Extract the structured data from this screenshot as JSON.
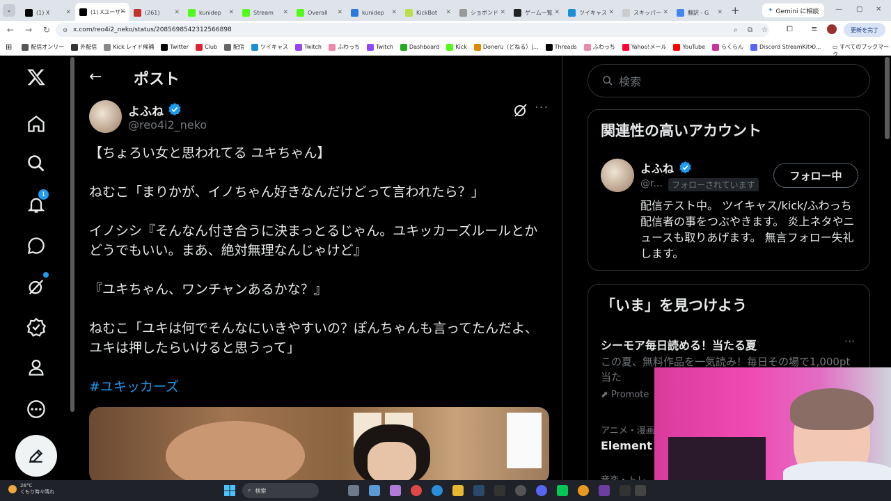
{
  "browser": {
    "tabs": [
      {
        "label": "(1) X",
        "fav": "#000",
        "active": false
      },
      {
        "label": "(1) Xユーザー",
        "fav": "#000",
        "active": true
      },
      {
        "label": "(261)",
        "fav": "#c4302b",
        "active": false
      },
      {
        "label": "kunidep",
        "fav": "#53fc18",
        "active": false
      },
      {
        "label": "Stream",
        "fav": "#53fc18",
        "active": false
      },
      {
        "label": "Overall",
        "fav": "#53fc18",
        "active": false
      },
      {
        "label": "kunidep",
        "fav": "#2a7bd8",
        "active": false
      },
      {
        "label": "KickBot",
        "fav": "#b9e04a",
        "active": false
      },
      {
        "label": "ショボンド",
        "fav": "#999",
        "active": false
      },
      {
        "label": "ゲーム一覧",
        "fav": "#222",
        "active": false
      },
      {
        "label": "ツイキャス",
        "fav": "#1a8fd6",
        "active": false
      },
      {
        "label": "スキッパー",
        "fav": "#ccc",
        "active": false
      },
      {
        "label": "翻訳 - G",
        "fav": "#4285f4",
        "active": false
      }
    ],
    "gemini_label": "Gemini に相談",
    "url": "x.com/reo4i2_neko/status/2085698542312566898",
    "update_label": "更新を完了",
    "bookmarks": [
      {
        "label": "配信オンリー",
        "color": "#555"
      },
      {
        "label": "外配信",
        "color": "#333"
      },
      {
        "label": "Kick レイド候補",
        "color": "#888"
      },
      {
        "label": "Twitter",
        "color": "#000"
      },
      {
        "label": "Club",
        "color": "#d23"
      },
      {
        "label": "配信",
        "color": "#666"
      },
      {
        "label": "ツイキャス",
        "color": "#1a8fd6"
      },
      {
        "label": "Twitch",
        "color": "#9146ff"
      },
      {
        "label": "ふわっち",
        "color": "#e8a"
      },
      {
        "label": "Twitch",
        "color": "#9146ff"
      },
      {
        "label": "Dashboard",
        "color": "#2a2"
      },
      {
        "label": "Kick",
        "color": "#53fc18"
      },
      {
        "label": "Doneru（どねる）|...",
        "color": "#d80"
      },
      {
        "label": "Threads",
        "color": "#000"
      },
      {
        "label": "ふわっち",
        "color": "#e8a"
      },
      {
        "label": "Yahoo!メール",
        "color": "#ff0033"
      },
      {
        "label": "YouTube",
        "color": "#f00"
      },
      {
        "label": "らくらん",
        "color": "#c39"
      },
      {
        "label": "Discord StreamKit O...",
        "color": "#5865f2"
      }
    ],
    "all_bookmarks": "すべてのブックマーク"
  },
  "post": {
    "header_title": "ポスト",
    "author_name": "よふね",
    "author_handle": "@reo4i2_neko",
    "lines": [
      "【ちょろい女と思われてる ユキちゃん】",
      "",
      "ねむこ「まりかが、イノちゃん好きなんだけどって言われたら？」",
      "",
      "イノシシ『そんなん付き合うに決まっとるじゃん。ユキッカーズルールとかどうでもいい。まあ、絶対無理なんじゃけど』",
      "",
      "『ユキちゃん、ワンチャンあるかな？』",
      "",
      "ねむこ「ユキは何でそんなにいきやすいの？ぽんちゃんも言ってたんだよ、ユキは押したらいけると思うって」",
      ""
    ],
    "hashtag": "#ユキッカーズ"
  },
  "sidebar": {
    "search_placeholder": "検索",
    "relevant_title": "関連性の高いアカウント",
    "account": {
      "name": "よふね",
      "handle": "@r...",
      "follows_you": "フォローされています",
      "follow_button": "フォロー中",
      "bio": "配信テスト中。 ツイキャス/kick/ふわっち 配信者の事をつぶやきます。 炎上ネタやニュースも取りあげます。 無言フォロー失礼します。"
    },
    "discover_title": "「いま」を見つけよう",
    "trend": {
      "name": "シーモア毎日読める！当たる夏",
      "desc": "この夏、無料作品を一気読み！毎日その場で1,000pt当た",
      "promoted": "Promote"
    },
    "trend2": {
      "category": "アニメ・漫画",
      "name": "Element S"
    },
    "trend3_category": "音楽・トレ"
  },
  "nav": {
    "notifications_badge": "1"
  },
  "taskbar": {
    "temp": "26°C",
    "weather": "くもり時々晴れ",
    "search_label": "検索"
  }
}
